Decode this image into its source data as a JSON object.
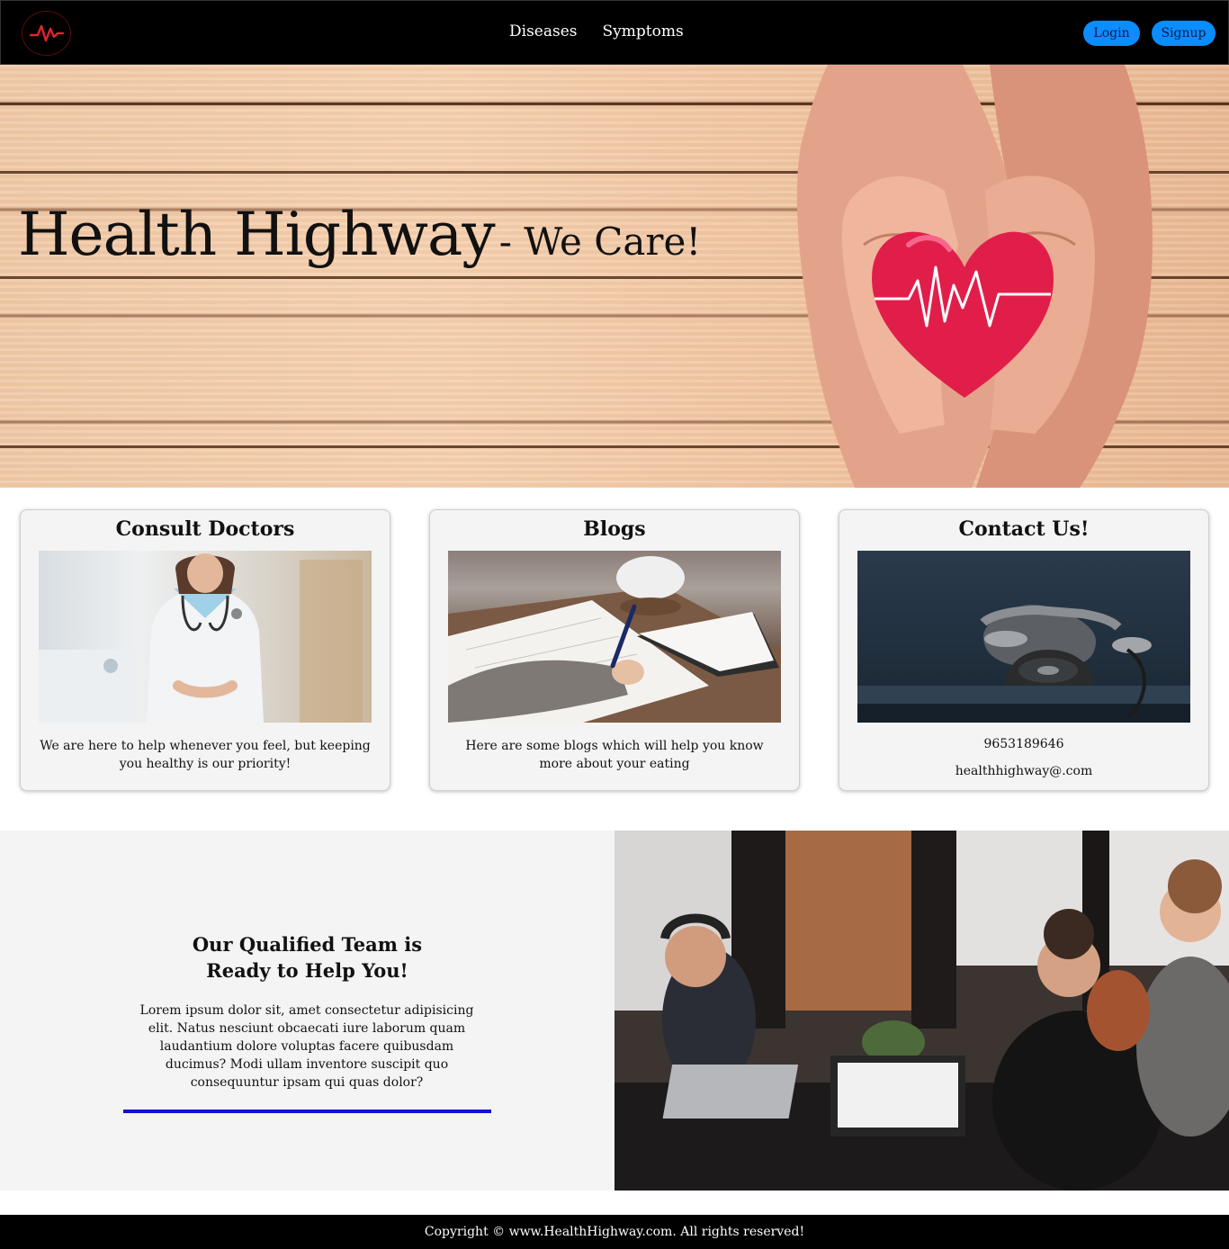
{
  "brand": {
    "logo_icon": "heartbeat-icon",
    "accent": "#e0242b"
  },
  "nav": {
    "links": [
      {
        "label": "Diseases"
      },
      {
        "label": "Symptoms"
      }
    ],
    "login_label": "Login",
    "signup_label": "Signup",
    "button_color": "#0a8dff"
  },
  "hero": {
    "title": "Health Highway",
    "tagline": "- We Care!",
    "image_icon": "hands-holding-heart-image"
  },
  "cards": [
    {
      "title": "Consult Doctors",
      "image_icon": "doctor-image",
      "text": "We are here to help whenever you feel, but keeping you healthy is our priority!"
    },
    {
      "title": "Blogs",
      "image_icon": "writing-notes-image",
      "text": "Here are some blogs which will help you know more about your eating"
    },
    {
      "title": "Contact Us!",
      "image_icon": "rotary-phone-image",
      "phone": "9653189646",
      "email": "healthhighway@.com"
    }
  ],
  "team": {
    "heading_line1": "Our Qualified Team is",
    "heading_line2": "Ready to Help You!",
    "text": "Lorem ipsum dolor sit, amet consectetur adipisicing elit. Natus nesciunt obcaecati iure laborum quam laudantium dolore voluptas facere quibusdam ducimus? Modi ullam inventore suscipit quo consequuntur ipsam qui quas dolor?",
    "bar_color": "#1010d6",
    "image_icon": "team-working-image"
  },
  "footer": {
    "text": "Copyright © www.HealthHighway.com. All rights reserved!"
  }
}
